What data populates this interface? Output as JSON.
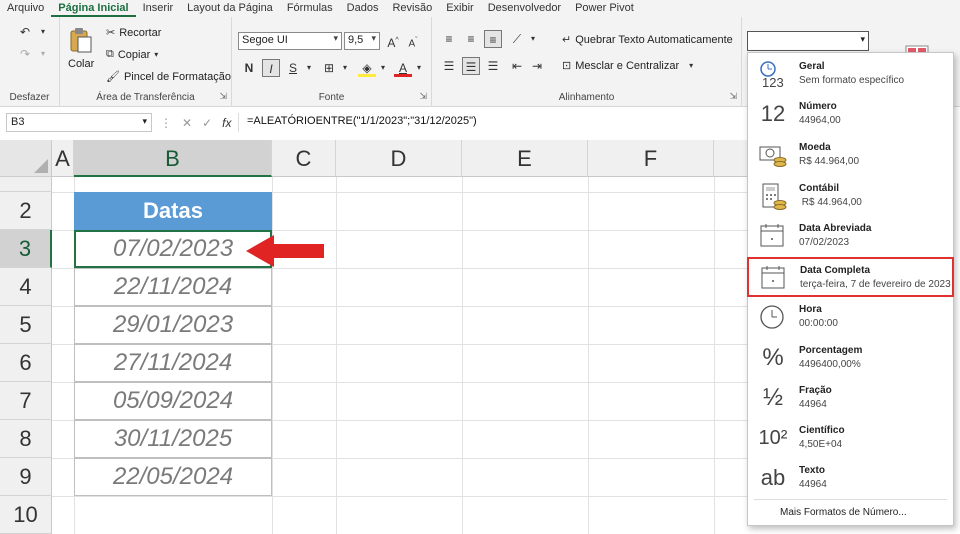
{
  "menu": {
    "tabs": [
      "Arquivo",
      "Página Inicial",
      "Inserir",
      "Layout da Página",
      "Fórmulas",
      "Dados",
      "Revisão",
      "Exibir",
      "Desenvolvedor",
      "Power Pivot"
    ],
    "active_index": 1
  },
  "ribbon": {
    "undo_group": "Desfazer",
    "clipboard": {
      "label": "Área de Transferência",
      "paste": "Colar",
      "cut": "Recortar",
      "copy": "Copiar",
      "format_painter": "Pincel de Formatação"
    },
    "font": {
      "label": "Fonte",
      "name": "Segoe UI",
      "size": "9,5",
      "bold": "N",
      "italic": "I",
      "underline": "S"
    },
    "alignment": {
      "label": "Alinhamento",
      "wrap": "Quebrar Texto Automaticamente",
      "merge": "Mesclar e Centralizar"
    },
    "number_format_value": ""
  },
  "formula_bar": {
    "name_box": "B3",
    "formula": "=ALEATÓRIOENTRE(\"1/1/2023\";\"31/12/2025\")"
  },
  "sheet": {
    "columns": [
      "A",
      "B",
      "C",
      "D",
      "E",
      "F"
    ],
    "rows": [
      "2",
      "3",
      "4",
      "5",
      "6",
      "7",
      "8",
      "9",
      "10"
    ],
    "selected_column": "B",
    "selected_row": "3",
    "header": "Datas",
    "dates": [
      "07/02/2023",
      "22/11/2024",
      "29/01/2023",
      "27/11/2024",
      "05/09/2024",
      "30/11/2025",
      "22/05/2024"
    ]
  },
  "number_formats": {
    "items": [
      {
        "name": "Geral",
        "example": "Sem formato específico",
        "icon": "123"
      },
      {
        "name": "Número",
        "example": "44964,00",
        "icon": "12"
      },
      {
        "name": "Moeda",
        "example": "R$ 44.964,00",
        "icon": "currency-icon"
      },
      {
        "name": "Contábil",
        "example": " R$ 44.964,00",
        "icon": "calculator-icon"
      },
      {
        "name": "Data Abreviada",
        "example": "07/02/2023",
        "icon": "calendar-icon"
      },
      {
        "name": "Data Completa",
        "example": "terça-feira, 7 de fevereiro de 2023",
        "icon": "calendar-icon"
      },
      {
        "name": "Hora",
        "example": "00:00:00",
        "icon": "clock-icon"
      },
      {
        "name": "Porcentagem",
        "example": "4496400,00%",
        "icon": "%"
      },
      {
        "name": "Fração",
        "example": "44964",
        "icon": "½"
      },
      {
        "name": "Científico",
        "example": "4,50E+04",
        "icon": "10²"
      },
      {
        "name": "Texto",
        "example": "44964",
        "icon": "ab"
      }
    ],
    "highlighted": "Data Completa",
    "more": "Mais Formatos de Número..."
  },
  "colors": {
    "excel_green": "#217346",
    "header_fill": "#5b9bd5",
    "highlight_border": "#e03131",
    "arrow": "#e02424"
  }
}
